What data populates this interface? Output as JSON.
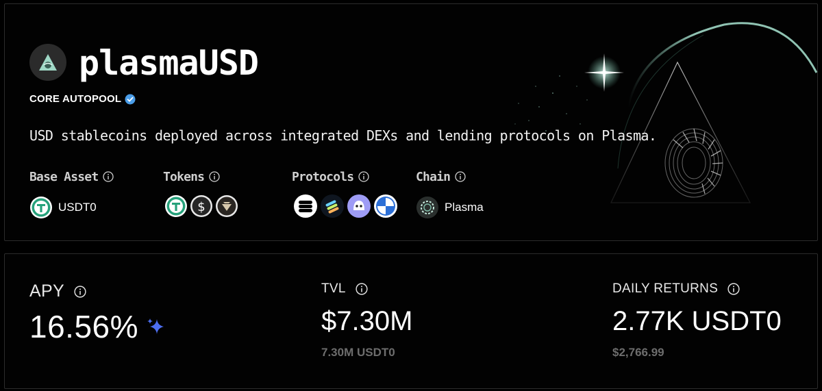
{
  "pool": {
    "name": "plasmaUSD",
    "category": "CORE AUTOPOOL",
    "description": "USD stablecoins deployed across integrated DEXs and lending protocols on Plasma."
  },
  "meta": {
    "base_asset": {
      "label": "Base Asset",
      "value": "USDT0",
      "icon": "usdt0-icon"
    },
    "tokens": {
      "label": "Tokens",
      "icons": [
        "usdt0-icon",
        "usd-icon",
        "token-icon"
      ]
    },
    "protocols": {
      "label": "Protocols",
      "icons": [
        "protocol-a-icon",
        "protocol-b-icon",
        "protocol-c-icon",
        "protocol-d-icon"
      ]
    },
    "chain": {
      "label": "Chain",
      "value": "Plasma",
      "icon": "plasma-icon"
    }
  },
  "stats": {
    "apy": {
      "label": "APY",
      "value": "16.56%"
    },
    "tvl": {
      "label": "TVL",
      "value": "$7.30M",
      "sub": "7.30M USDT0"
    },
    "daily_returns": {
      "label": "DAILY RETURNS",
      "value": "2.77K USDT0",
      "sub": "$2,766.99"
    }
  },
  "colors": {
    "accent_teal": "#9fd8c6",
    "usdt_green": "#26a17b",
    "verified_blue": "#4a9de8",
    "sparkle_blue": "#4d6ef0",
    "sub_text": "#6d6d6d"
  }
}
